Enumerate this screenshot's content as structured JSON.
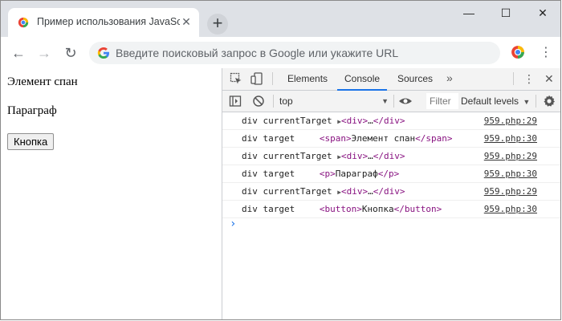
{
  "browser": {
    "tab_title": "Пример использования JavaScript",
    "tab_close": "✕",
    "new_tab": "+",
    "window_controls": {
      "minimize": "—",
      "maximize": "☐",
      "close": "✕"
    },
    "address_placeholder": "Введите поисковый запрос в Google или укажите URL",
    "nav": {
      "back": "←",
      "forward": "→",
      "reload": "↻"
    },
    "menu": "⋮"
  },
  "page": {
    "span_text": "Элемент спан",
    "paragraph_text": "Параграф",
    "button_label": "Кнопка"
  },
  "devtools": {
    "tabs": [
      {
        "label": "Elements",
        "active": false
      },
      {
        "label": "Console",
        "active": true
      },
      {
        "label": "Sources",
        "active": false
      }
    ],
    "more_tabs": "»",
    "kebab": "⋮",
    "close": "✕",
    "console": {
      "context": "top",
      "filter_placeholder": "Filter",
      "levels": "Default levels",
      "prompt": "›",
      "rows": [
        {
          "prefix": "div currentTarget",
          "expand": "▶",
          "tag_open": "<div>",
          "inner": "…",
          "tag_close": "</div>",
          "source": "959.php:29"
        },
        {
          "prefix": "div target",
          "expand": "",
          "tag_open": "<span>",
          "inner": "Элемент спан",
          "tag_close": "</span>",
          "source": "959.php:30"
        },
        {
          "prefix": "div currentTarget",
          "expand": "▶",
          "tag_open": "<div>",
          "inner": "…",
          "tag_close": "</div>",
          "source": "959.php:29"
        },
        {
          "prefix": "div target",
          "expand": "",
          "tag_open": "<p>",
          "inner": "Параграф",
          "tag_close": "</p>",
          "source": "959.php:30"
        },
        {
          "prefix": "div currentTarget",
          "expand": "▶",
          "tag_open": "<div>",
          "inner": "…",
          "tag_close": "</div>",
          "source": "959.php:29"
        },
        {
          "prefix": "div target",
          "expand": "",
          "tag_open": "<button>",
          "inner": "Кнопка",
          "tag_close": "</button>",
          "source": "959.php:30"
        }
      ]
    }
  },
  "colors": {
    "tab_strip": "#dee1e6",
    "accent_blue": "#1a73e8",
    "tag_purple": "#881280"
  }
}
